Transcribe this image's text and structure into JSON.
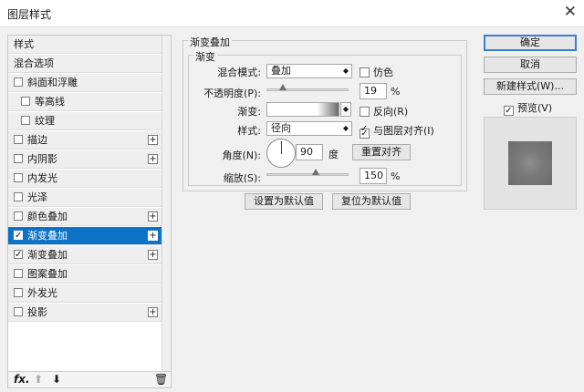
{
  "window": {
    "title": "图层样式",
    "close_glyph": "✕"
  },
  "style_list": [
    {
      "label": "样式",
      "has_checkbox": false,
      "checked": false,
      "has_plus": false,
      "indent": false,
      "selected": false
    },
    {
      "label": "混合选项",
      "has_checkbox": false,
      "checked": false,
      "has_plus": false,
      "indent": false,
      "selected": false
    },
    {
      "label": "斜面和浮雕",
      "has_checkbox": true,
      "checked": false,
      "has_plus": false,
      "indent": false,
      "selected": false
    },
    {
      "label": "等高线",
      "has_checkbox": true,
      "checked": false,
      "has_plus": false,
      "indent": true,
      "selected": false
    },
    {
      "label": "纹理",
      "has_checkbox": true,
      "checked": false,
      "has_plus": false,
      "indent": true,
      "selected": false
    },
    {
      "label": "描边",
      "has_checkbox": true,
      "checked": false,
      "has_plus": true,
      "indent": false,
      "selected": false
    },
    {
      "label": "内阴影",
      "has_checkbox": true,
      "checked": false,
      "has_plus": true,
      "indent": false,
      "selected": false
    },
    {
      "label": "内发光",
      "has_checkbox": true,
      "checked": false,
      "has_plus": false,
      "indent": false,
      "selected": false
    },
    {
      "label": "光泽",
      "has_checkbox": true,
      "checked": false,
      "has_plus": false,
      "indent": false,
      "selected": false
    },
    {
      "label": "颜色叠加",
      "has_checkbox": true,
      "checked": false,
      "has_plus": true,
      "indent": false,
      "selected": false
    },
    {
      "label": "渐变叠加",
      "has_checkbox": true,
      "checked": true,
      "has_plus": true,
      "indent": false,
      "selected": true
    },
    {
      "label": "渐变叠加",
      "has_checkbox": true,
      "checked": true,
      "has_plus": true,
      "indent": false,
      "selected": false
    },
    {
      "label": "图案叠加",
      "has_checkbox": true,
      "checked": false,
      "has_plus": false,
      "indent": false,
      "selected": false
    },
    {
      "label": "外发光",
      "has_checkbox": true,
      "checked": false,
      "has_plus": false,
      "indent": false,
      "selected": false
    },
    {
      "label": "投影",
      "has_checkbox": true,
      "checked": false,
      "has_plus": true,
      "indent": false,
      "selected": false
    }
  ],
  "left_bottom": {
    "fx": "fx.",
    "up": "⬆",
    "down": "⬇",
    "trash": "🗑"
  },
  "panel": {
    "group_title": "渐变叠加",
    "subgroup_title": "渐变",
    "blend_mode": {
      "label": "混合模式:",
      "value": "叠加"
    },
    "dither": {
      "label": "仿色",
      "checked": false
    },
    "opacity": {
      "label": "不透明度(P):",
      "value": "19",
      "unit": "%",
      "fraction": 0.19
    },
    "gradient": {
      "label": "渐变:"
    },
    "reverse": {
      "label": "反向(R)",
      "checked": false
    },
    "style": {
      "label": "样式:",
      "value": "径向"
    },
    "align": {
      "label": "与图层对齐(I)",
      "checked": true
    },
    "angle": {
      "label": "角度(N):",
      "value": "90",
      "unit": "度"
    },
    "reset_button": "重置对齐",
    "scale": {
      "label": "缩放(S):",
      "value": "150",
      "unit": "%",
      "fraction": 0.6
    },
    "make_default": "设置为默认值",
    "reset_default": "复位为默认值"
  },
  "right": {
    "ok": "确定",
    "cancel": "取消",
    "new_style": "新建样式(W)...",
    "preview": {
      "label": "预览(V)",
      "checked": true
    }
  },
  "icons": {
    "dropdown": "◆",
    "check": "✓",
    "plus": "+"
  }
}
